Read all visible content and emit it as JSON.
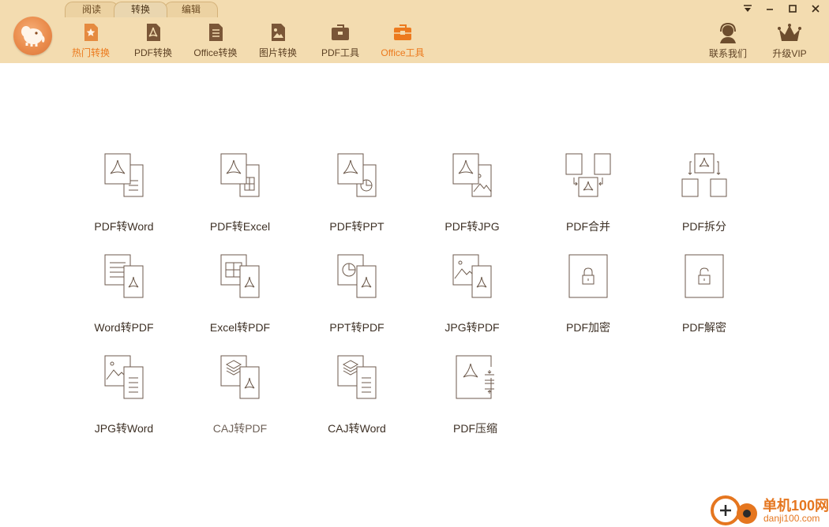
{
  "mode_tabs": [
    {
      "label": "阅读"
    },
    {
      "label": "转换"
    },
    {
      "label": "编辑"
    }
  ],
  "nav": [
    {
      "label": "热门转换",
      "icon": "star-doc-icon",
      "active": false
    },
    {
      "label": "PDF转换",
      "icon": "pdf-doc-icon",
      "active": false
    },
    {
      "label": "Office转换",
      "icon": "office-doc-icon",
      "active": false
    },
    {
      "label": "图片转换",
      "icon": "image-doc-icon",
      "active": false
    },
    {
      "label": "PDF工具",
      "icon": "toolbox-icon",
      "active": false
    },
    {
      "label": "Office工具",
      "icon": "office-toolbox-icon",
      "active": true
    }
  ],
  "right_nav": {
    "contact": "联系我们",
    "vip": "升级VIP"
  },
  "tools": [
    {
      "label": "PDF转Word"
    },
    {
      "label": "PDF转Excel"
    },
    {
      "label": "PDF转PPT"
    },
    {
      "label": "PDF转JPG"
    },
    {
      "label": "PDF合并"
    },
    {
      "label": "PDF拆分"
    },
    {
      "label": "Word转PDF"
    },
    {
      "label": "Excel转PDF"
    },
    {
      "label": "PPT转PDF"
    },
    {
      "label": "JPG转PDF"
    },
    {
      "label": "PDF加密"
    },
    {
      "label": "PDF解密"
    },
    {
      "label": "JPG转Word"
    },
    {
      "label": "CAJ转PDF"
    },
    {
      "label": "CAJ转Word"
    },
    {
      "label": "PDF压缩"
    }
  ],
  "watermark": {
    "title": "单机100网",
    "url": "danji100.com"
  },
  "colors": {
    "header_bg": "#f3dcb0",
    "accent": "#ec7a1e",
    "icon_stroke": "#6d5a4c"
  }
}
